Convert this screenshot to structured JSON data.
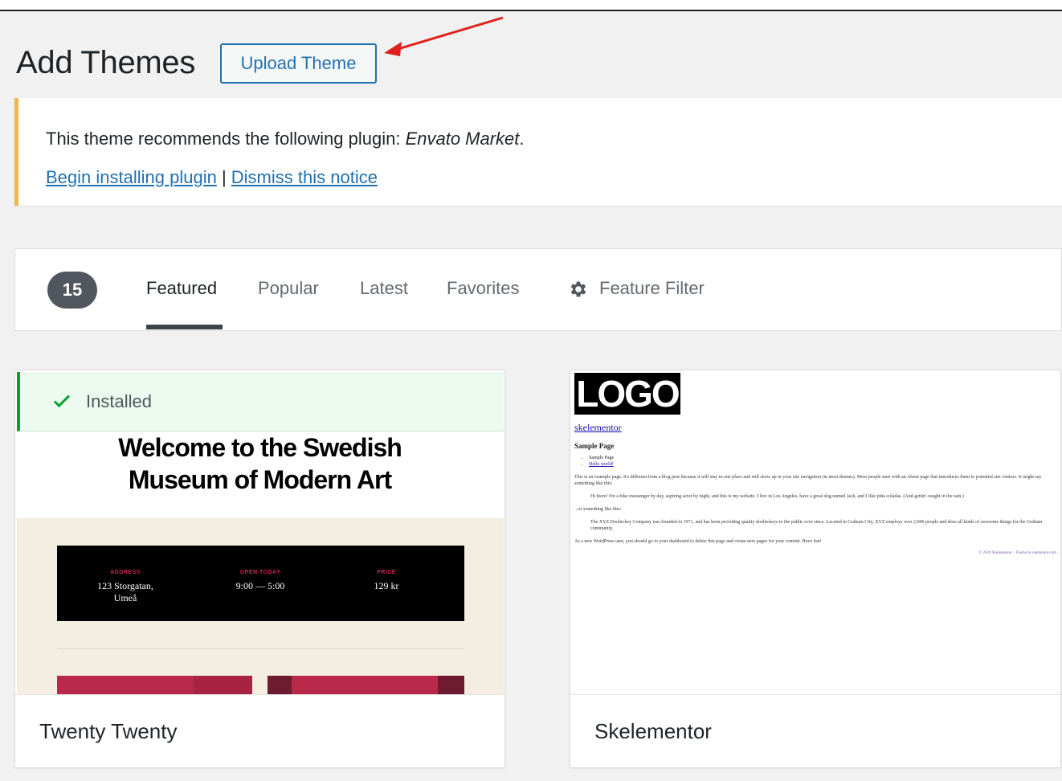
{
  "header": {
    "title": "Add Themes",
    "upload_button": "Upload Theme"
  },
  "notice": {
    "text_prefix": "This theme recommends the following plugin: ",
    "plugin_name": "Envato Market",
    "text_suffix": ".",
    "link_install": "Begin installing plugin",
    "separator": " | ",
    "link_dismiss": "Dismiss this notice",
    "border_color": "#f0b849"
  },
  "filters": {
    "count": "15",
    "tabs": [
      {
        "label": "Featured",
        "active": true
      },
      {
        "label": "Popular",
        "active": false
      },
      {
        "label": "Latest",
        "active": false
      },
      {
        "label": "Favorites",
        "active": false
      }
    ],
    "feature_filter": "Feature Filter"
  },
  "themes": [
    {
      "name": "Twenty Twenty",
      "installed_label": "Installed",
      "preview": {
        "headline": "Welcome to the Swedish Museum of Modern Art",
        "columns": [
          {
            "label": "ADDRESS",
            "value": "123 Storgatan, Umeå"
          },
          {
            "label": "OPEN TODAY",
            "value": "9:00 — 5:00"
          },
          {
            "label": "PRICE",
            "value": "129 kr"
          }
        ]
      }
    },
    {
      "name": "Skelementor",
      "preview": {
        "logo": "LOGO",
        "site_link": "skelementor",
        "page_title": "Sample Page",
        "list_items": [
          "Sample Page",
          "Hello world!"
        ],
        "paragraph_1": "This is an example page. It's different from a blog post because it will stay in one place and will show up in your site navigation (in most themes). Most people start with an About page that introduces them to potential site visitors. It might say something like this:",
        "paragraph_2": "Hi there! I'm a bike messenger by day, aspiring actor by night, and this is my website. I live in Los Angeles, have a great dog named Jack, and I like piña coladas. (And gettin' caught in the rain.)",
        "paragraph_3": "...or something like this:",
        "paragraph_4": "The XYZ Doohickey Company was founded in 1971, and has been providing quality doohickeys to the public ever since. Located in Gotham City, XYZ employs over 2,000 people and does all kinds of awesome things for the Gotham community.",
        "paragraph_5": "As a new WordPress user, you should go to your dashboard to delete this page and create new pages for your content. Have fun!",
        "footer": "© 2020 Skelementor · Theme by elementor.com"
      }
    }
  ]
}
